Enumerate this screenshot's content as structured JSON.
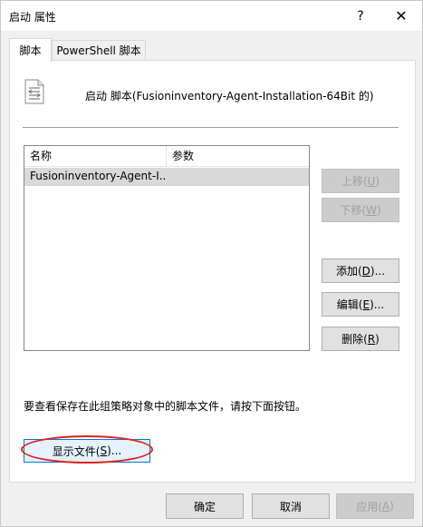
{
  "window": {
    "title": "启动 属性",
    "help_glyph": "?",
    "close_glyph": "✕"
  },
  "tabs": [
    {
      "label": "脚本",
      "active": true
    },
    {
      "label": "PowerShell 脚本",
      "active": false
    }
  ],
  "header": {
    "icon": "script-icon",
    "text": "启动 脚本(Fusioninventory-Agent-Installation-64Bit 的)"
  },
  "list": {
    "columns": [
      "名称",
      "参数"
    ],
    "rows": [
      {
        "name": "Fusioninventory-Agent-I...",
        "params": ""
      }
    ]
  },
  "buttons": {
    "move_up": {
      "text": "上移(",
      "key": "U",
      "suffix": ")",
      "enabled": false
    },
    "move_down": {
      "text": "下移(",
      "key": "W",
      "suffix": ")",
      "enabled": false
    },
    "add": {
      "text": "添加(",
      "key": "D",
      "suffix": ")..."
    },
    "edit": {
      "text": "编辑(",
      "key": "E",
      "suffix": ")..."
    },
    "remove": {
      "text": "删除(",
      "key": "R",
      "suffix": ")"
    },
    "show_files": {
      "text": "显示文件(",
      "key": "S",
      "suffix": ")..."
    }
  },
  "info_text": "要查看保存在此组策略对象中的脚本文件，请按下面按钮。",
  "footer": {
    "ok": "确定",
    "cancel": "取消",
    "apply": {
      "text": "应用(",
      "key": "A",
      "suffix": ")",
      "enabled": false
    }
  },
  "colors": {
    "highlight_ring": "#e0201c",
    "focus_border": "#0078d7"
  }
}
